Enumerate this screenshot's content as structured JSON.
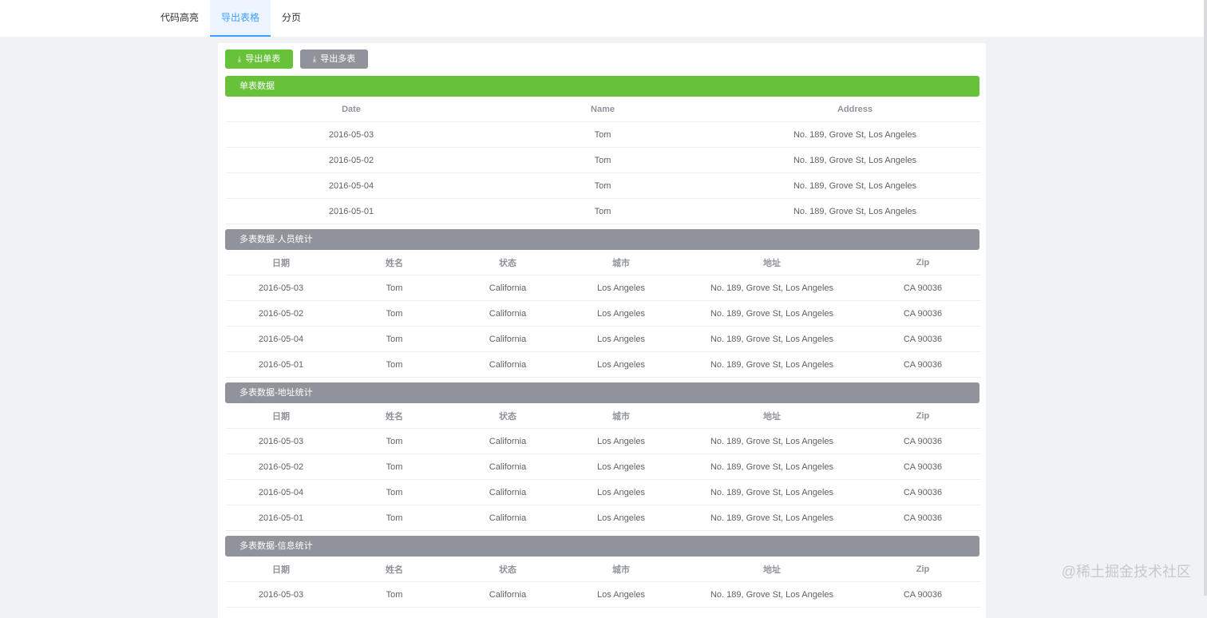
{
  "nav": {
    "tabs": [
      {
        "label": "代码高亮"
      },
      {
        "label": "导出表格"
      },
      {
        "label": "分页"
      }
    ]
  },
  "toolbar": {
    "export_single_label": "导出单表",
    "export_multi_label": "导出多表",
    "download_icon": "download-icon"
  },
  "single": {
    "title": "单表数据",
    "columns": [
      "Date",
      "Name",
      "Address"
    ],
    "rows": [
      [
        "2016-05-03",
        "Tom",
        "No. 189, Grove St, Los Angeles"
      ],
      [
        "2016-05-02",
        "Tom",
        "No. 189, Grove St, Los Angeles"
      ],
      [
        "2016-05-04",
        "Tom",
        "No. 189, Grove St, Los Angeles"
      ],
      [
        "2016-05-01",
        "Tom",
        "No. 189, Grove St, Los Angeles"
      ]
    ]
  },
  "multi": {
    "columns": [
      "日期",
      "姓名",
      "状态",
      "城市",
      "地址",
      "Zip"
    ],
    "tables": [
      {
        "title": "多表数据-人员统计",
        "rows": [
          [
            "2016-05-03",
            "Tom",
            "California",
            "Los Angeles",
            "No. 189, Grove St, Los Angeles",
            "CA 90036"
          ],
          [
            "2016-05-02",
            "Tom",
            "California",
            "Los Angeles",
            "No. 189, Grove St, Los Angeles",
            "CA 90036"
          ],
          [
            "2016-05-04",
            "Tom",
            "California",
            "Los Angeles",
            "No. 189, Grove St, Los Angeles",
            "CA 90036"
          ],
          [
            "2016-05-01",
            "Tom",
            "California",
            "Los Angeles",
            "No. 189, Grove St, Los Angeles",
            "CA 90036"
          ]
        ]
      },
      {
        "title": "多表数据-地址统计",
        "rows": [
          [
            "2016-05-03",
            "Tom",
            "California",
            "Los Angeles",
            "No. 189, Grove St, Los Angeles",
            "CA 90036"
          ],
          [
            "2016-05-02",
            "Tom",
            "California",
            "Los Angeles",
            "No. 189, Grove St, Los Angeles",
            "CA 90036"
          ],
          [
            "2016-05-04",
            "Tom",
            "California",
            "Los Angeles",
            "No. 189, Grove St, Los Angeles",
            "CA 90036"
          ],
          [
            "2016-05-01",
            "Tom",
            "California",
            "Los Angeles",
            "No. 189, Grove St, Los Angeles",
            "CA 90036"
          ]
        ]
      },
      {
        "title": "多表数据-信息统计",
        "rows": [
          [
            "2016-05-03",
            "Tom",
            "California",
            "Los Angeles",
            "No. 189, Grove St, Los Angeles",
            "CA 90036"
          ]
        ]
      }
    ]
  },
  "watermark": "@稀土掘金技术社区",
  "colors": {
    "green": "#67c23a",
    "gray": "#909399",
    "active_tab": "#409eff",
    "page_bg": "#f0f2f5"
  }
}
